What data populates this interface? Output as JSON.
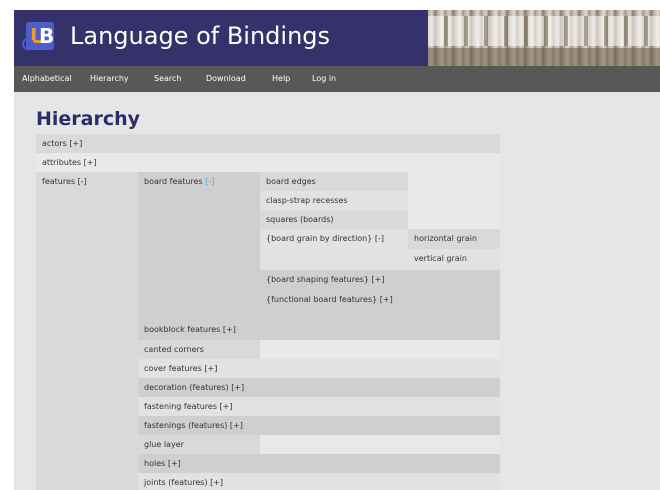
{
  "site": {
    "title": "Language of Bindings",
    "logo_letters": "LB"
  },
  "nav": {
    "items": [
      "Alphabetical",
      "Hierarchy",
      "Search",
      "Download",
      "Help",
      "Log in"
    ]
  },
  "page": {
    "heading": "Hierarchy"
  },
  "tree": {
    "actors": "actors [+]",
    "attributes": "attributes [+]",
    "features": "features [-]",
    "board_features": "board features",
    "board_features_toggle": "[-]",
    "board_children": [
      "board edges",
      "clasp-strap recesses",
      "squares (boards)",
      "{board grain by direction} [-]",
      "{board shaping features} [+]",
      "{functional board features} [+]"
    ],
    "grain_children": [
      "horizontal grain",
      "vertical grain"
    ],
    "feature_children": [
      "bookblock features [+]",
      "canted corners",
      "cover features [+]",
      "decoration (features) [+]",
      "fastening features [+]",
      "fastenings (features) [+]",
      "glue layer",
      "holes [+]",
      "joints (features) [+]"
    ]
  }
}
